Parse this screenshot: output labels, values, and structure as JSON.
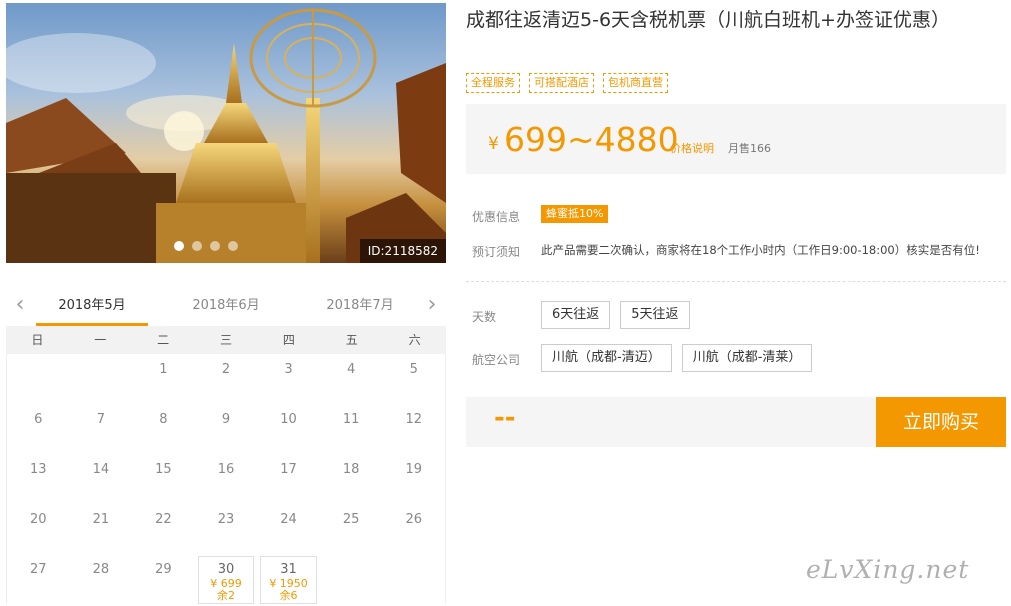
{
  "hero": {
    "image_id": "ID:2118582",
    "dots": 4
  },
  "calendar": {
    "months": [
      "2018年5月",
      "2018年6月",
      "2018年7月"
    ],
    "active_month": "2018年5月",
    "prev_icon": "chevron-left-icon",
    "next_icon": "chevron-right-icon",
    "weekdays": [
      "日",
      "一",
      "二",
      "三",
      "四",
      "五",
      "六"
    ],
    "cells": [
      {
        "day": ""
      },
      {
        "day": ""
      },
      {
        "day": "1"
      },
      {
        "day": "2"
      },
      {
        "day": "3"
      },
      {
        "day": "4"
      },
      {
        "day": "5"
      },
      {
        "day": "6"
      },
      {
        "day": "7"
      },
      {
        "day": "8"
      },
      {
        "day": "9"
      },
      {
        "day": "10"
      },
      {
        "day": "11"
      },
      {
        "day": "12"
      },
      {
        "day": "13"
      },
      {
        "day": "14"
      },
      {
        "day": "15"
      },
      {
        "day": "16"
      },
      {
        "day": "17"
      },
      {
        "day": "18"
      },
      {
        "day": "19"
      },
      {
        "day": "20"
      },
      {
        "day": "21"
      },
      {
        "day": "22"
      },
      {
        "day": "23"
      },
      {
        "day": "24"
      },
      {
        "day": "25"
      },
      {
        "day": "26"
      },
      {
        "day": "27"
      },
      {
        "day": "28"
      },
      {
        "day": "29"
      },
      {
        "day": "30",
        "price": "¥ 699",
        "stock": "余2"
      },
      {
        "day": "31",
        "price": "¥ 1950",
        "stock": "余6"
      }
    ]
  },
  "product": {
    "title": "成都往返清迈5-6天含税机票（川航白班机+办签证优惠）",
    "tags": [
      "全程服务",
      "可搭配酒店",
      "包机商直营"
    ],
    "price_symbol": "¥",
    "price_range": "699~4880",
    "price_note": "价格说明",
    "monthly_sales": "月售166"
  },
  "info": {
    "discount_label": "优惠信息",
    "discount_badge": "蜂蜜抵10%",
    "notice_label": "预订须知",
    "notice_text": "此产品需要二次确认，商家将在18个工作小时内（工作日9:00-18:00）核实是否有位!"
  },
  "options": {
    "days_label": "天数",
    "days": [
      "6天往返",
      "5天往返"
    ],
    "airline_label": "航空公司",
    "airlines": [
      "川航（成都-清迈）",
      "川航（成都-清莱）"
    ]
  },
  "buy": {
    "total": "--",
    "button": "立即购买"
  },
  "watermark": "eLvXing.net",
  "colors": {
    "accent": "#f39800",
    "panel": "#f5f5f5"
  }
}
